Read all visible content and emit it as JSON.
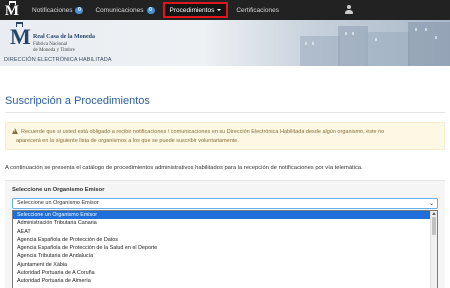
{
  "navbar": {
    "brand_letter": "M",
    "items": [
      {
        "label": "Notificaciones",
        "badge": "0"
      },
      {
        "label": "Comunicaciones",
        "badge": "0"
      },
      {
        "label": "Procedimientos"
      },
      {
        "label": "Certificaciones"
      }
    ],
    "highlight_color": "#e0161d"
  },
  "banner": {
    "crest_letter": "M",
    "title": "Real Casa de la Moneda",
    "subtitle1": "Fábrica Nacional",
    "subtitle2": "de Moneda y Timbre",
    "section_label": "DIRECCIÓN ELECTRÓNICA HABILITADA"
  },
  "main": {
    "title": "Suscripción a Procedimientos",
    "alert_line1": "Recuerde que si usted está obligado a recibir notificaciones / comunicaciones en su Dirección Electrónica Habilitada desde algún organismo, éste no",
    "alert_line2": "aparecerá en la siguiente lista de organismos a los que se puede suscribir voluntariamente.",
    "intro": "A continuación se presenta el catálogo de procedimientos administrativos habilitados para la recepción de notificaciones por vía telemática."
  },
  "form": {
    "label": "Seleccione un Organismo Emisor",
    "selected": "Seleccione un Organismo Emisor",
    "options": [
      "Seleccione un Organismo Emisor",
      "Administración Tributaria Canaria",
      "AEAT",
      "Agencia Española de Protección de Datos",
      "Agencia Española de Protección de la Salud en el Deporte",
      "Agencia Tributaria de Andalucía",
      "Ajuntament de Xàbia",
      "Autoridad Portuaria de A Coruña",
      "Autoridad Portuaria de Almería"
    ],
    "accent_color": "#1e6fd9"
  }
}
